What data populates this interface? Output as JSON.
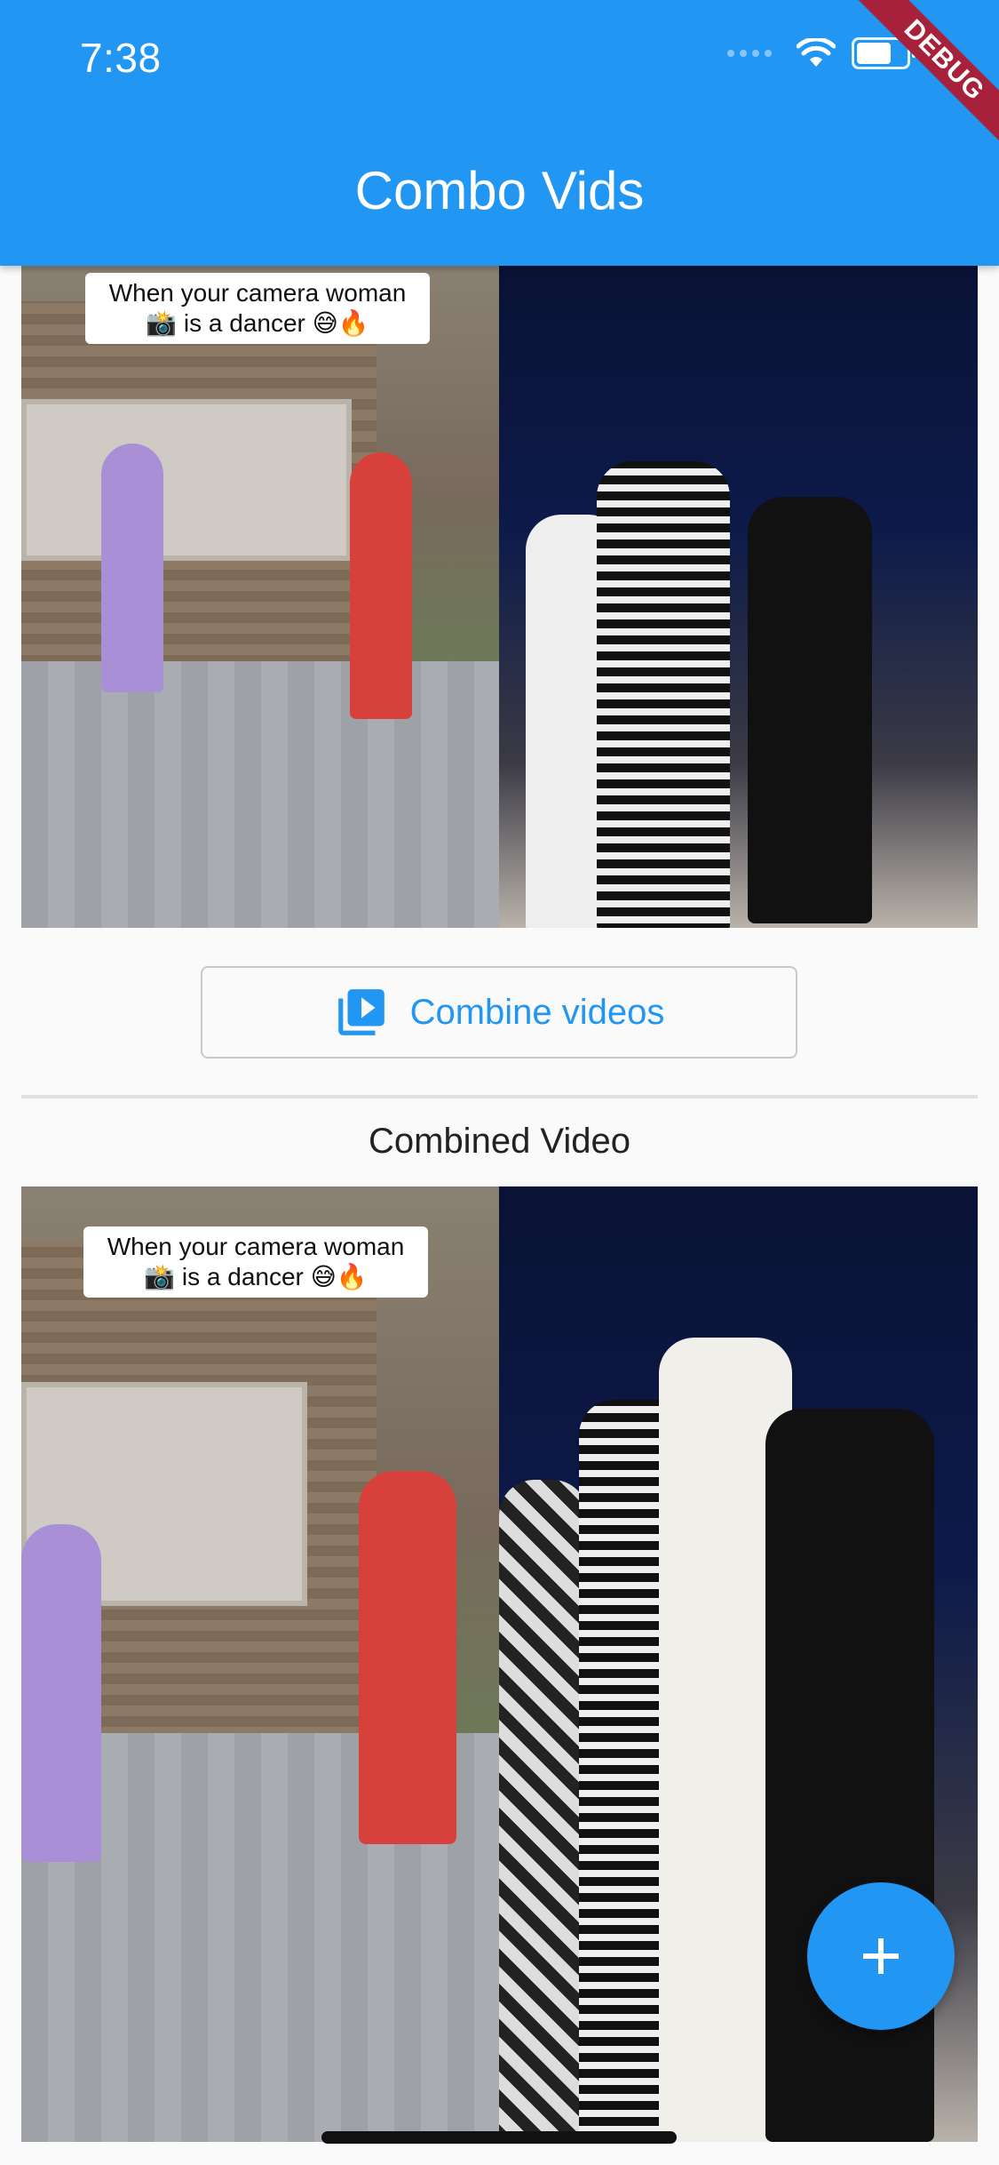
{
  "status_bar": {
    "time": "7:38"
  },
  "app_bar": {
    "title": "Combo Vids"
  },
  "debug_banner": "DEBUG",
  "video_top": {
    "caption_line1": "When your camera woman",
    "caption_line2": "📸 is a dancer 😅🔥"
  },
  "combine_button": {
    "label": "Combine videos",
    "icon": "video-library-icon"
  },
  "combined_section": {
    "label": "Combined Video"
  },
  "video_bottom": {
    "caption_line1": "When your camera woman",
    "caption_line2": "📸 is a dancer 😅🔥"
  },
  "fab": {
    "icon": "plus-icon"
  },
  "colors": {
    "primary": "#2196F3",
    "debug": "#A8213A"
  }
}
